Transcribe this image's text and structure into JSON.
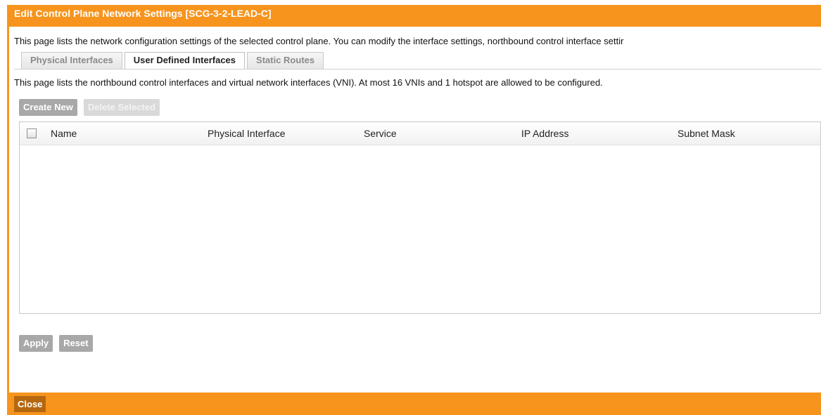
{
  "dialog": {
    "title": "Edit Control Plane Network Settings [SCG-3-2-LEAD-C]",
    "intro": "This page lists the network configuration settings of the selected control plane. You can modify the interface settings, northbound control interface settir"
  },
  "tabs": [
    {
      "label": "Physical Interfaces",
      "active": false
    },
    {
      "label": "User Defined Interfaces",
      "active": true
    },
    {
      "label": "Static Routes",
      "active": false
    }
  ],
  "description": "This page lists the northbound control interfaces and virtual network interfaces (VNI). At most 16 VNIs and 1 hotspot are allowed to be configured.",
  "toolbar": {
    "create_label": "Create New",
    "delete_label": "Delete Selected"
  },
  "table": {
    "columns": [
      "Name",
      "Physical Interface",
      "Service",
      "IP Address",
      "Subnet Mask"
    ],
    "rows": []
  },
  "actions": {
    "apply_label": "Apply",
    "reset_label": "Reset"
  },
  "footer": {
    "close_label": "Close"
  },
  "colors": {
    "accent": "#f7941d",
    "close_button": "#b56710",
    "button": "#a8a8a8",
    "button_disabled": "#d9d9d9"
  }
}
